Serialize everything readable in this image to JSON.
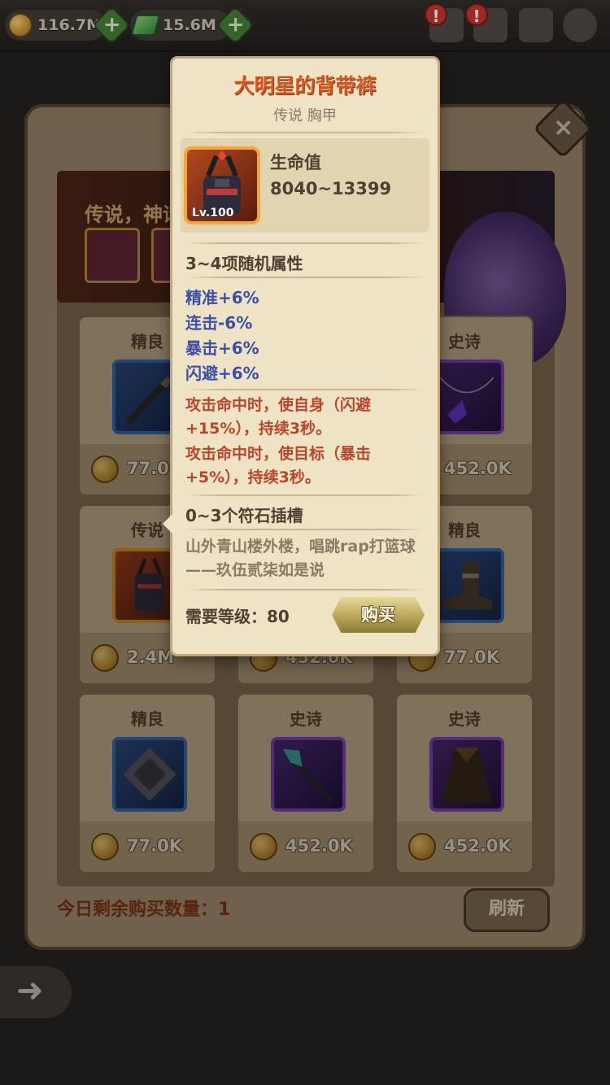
{
  "topbar": {
    "gold": "116.7M",
    "gems": "15.6M",
    "alerts": [
      "!",
      "!"
    ]
  },
  "shop": {
    "banner_text": "传说，神话",
    "remaining_label": "今日剩余购买数量：1",
    "refresh_label": "刷新",
    "close_icon": "×",
    "back_icon": "➜",
    "cards": [
      {
        "rarity": "精良",
        "price": "77.0K",
        "frame": "rare"
      },
      {
        "rarity": "",
        "price": "",
        "frame": "hidden"
      },
      {
        "rarity": "史诗",
        "price": "452.0K",
        "frame": "epic"
      },
      {
        "rarity": "传说",
        "price": "2.4M",
        "frame": "legend"
      },
      {
        "rarity": "",
        "price": "452.0K",
        "frame": "hidden"
      },
      {
        "rarity": "精良",
        "price": "77.0K",
        "frame": "rare"
      },
      {
        "rarity": "精良",
        "price": "77.0K",
        "frame": "rare"
      },
      {
        "rarity": "史诗",
        "price": "452.0K",
        "frame": "epic"
      },
      {
        "rarity": "史诗",
        "price": "452.0K",
        "frame": "epic"
      }
    ]
  },
  "popup": {
    "title": "大明星的背带裤",
    "subtitle": "传说 胸甲",
    "item_level": "Lv.100",
    "stat_name": "生命值",
    "stat_value": "8040~13399",
    "random_title": "3~4项随机属性",
    "attributes": [
      "精准+6%",
      "连击-6%",
      "暴击+6%",
      "闪避+6%"
    ],
    "effects": [
      "攻击命中时，使自身（闪避+15%），持续3秒。",
      "攻击命中时，使目标（暴击+5%），持续3秒。"
    ],
    "socket_text": "0~3个符石插槽",
    "flavor": "山外青山楼外楼，唱跳rap打篮球——玖伍贰柒如是说",
    "requirement": "需要等级：80",
    "buy_label": "购买"
  }
}
